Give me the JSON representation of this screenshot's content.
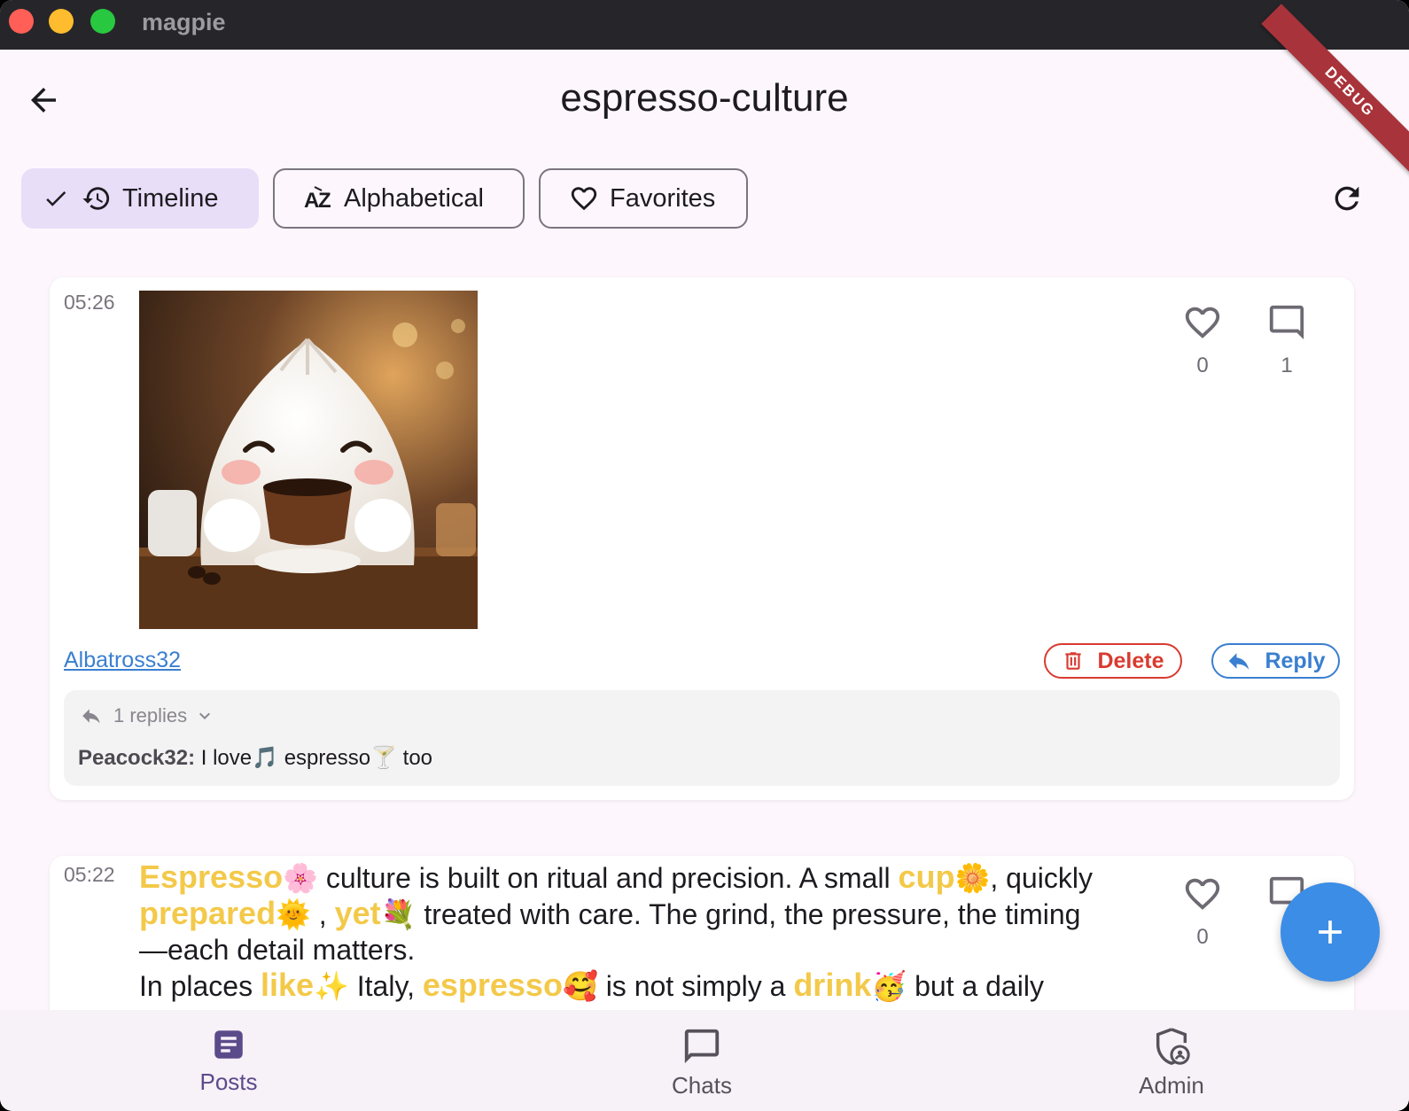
{
  "window": {
    "app_name": "magpie",
    "debug_label": "DEBUG"
  },
  "appbar": {
    "title": "espresso-culture"
  },
  "filters": [
    {
      "label": "Timeline",
      "selected": true,
      "icon": "history-icon"
    },
    {
      "label": "Alphabetical",
      "selected": false,
      "icon": "sort-az-icon"
    },
    {
      "label": "Favorites",
      "selected": false,
      "icon": "heart-outline-icon"
    }
  ],
  "posts": [
    {
      "time": "05:26",
      "image": "cartoon-bun-drinking-coffee",
      "likes": "0",
      "comments": "1",
      "author": "Albatross32",
      "delete_label": "Delete",
      "reply_label": "Reply",
      "replies_label": "1 replies",
      "reply": {
        "author": "Peacock32:",
        "t1": "I love",
        "e1": "🎵",
        "t2": "espresso",
        "e2": "🍸",
        "t3": "too"
      }
    },
    {
      "time": "05:22",
      "likes": "0",
      "text": {
        "w1": "Espresso",
        "e1": "🌸",
        "s1": "culture is built on ritual and precision. A small",
        "w2": "cup",
        "e2": "🌼",
        "s2": ", quickly",
        "w3": "prepared",
        "e3": "🌞",
        "s3": ",",
        "w4": "yet",
        "e4": "💐",
        "s4": "treated with care. The grind, the pressure, the timing",
        "line3": "—each detail matters.",
        "s5": "In places",
        "w5": "like",
        "e5": "✨",
        "s6": "Italy,",
        "w6": "espresso",
        "e6": "🥰",
        "s7": "is not simply a",
        "w7": "drink",
        "e7": "🥳",
        "s8": "but a daily"
      }
    }
  ],
  "nav": [
    {
      "label": "Posts",
      "icon": "posts-icon",
      "active": true
    },
    {
      "label": "Chats",
      "icon": "chat-bubble-icon",
      "active": false
    },
    {
      "label": "Admin",
      "icon": "admin-shield-icon",
      "active": false
    }
  ],
  "colors": {
    "accent": "#3c8de6",
    "delete": "#d93a30",
    "highlight": "#f3c94a",
    "chip_selected": "#e8def8"
  }
}
